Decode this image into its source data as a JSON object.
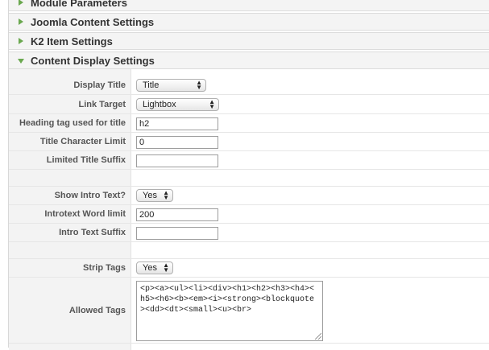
{
  "panels": [
    {
      "title": "Module Parameters",
      "expanded": false
    },
    {
      "title": "Joomla Content Settings",
      "expanded": false
    },
    {
      "title": "K2 Item Settings",
      "expanded": false
    },
    {
      "title": "Content Display Settings",
      "expanded": true
    }
  ],
  "fields": {
    "display_title": {
      "label": "Display Title",
      "value": "Title"
    },
    "link_target": {
      "label": "Link Target",
      "value": "Lightbox"
    },
    "heading_tag": {
      "label": "Heading tag used for title",
      "value": "h2"
    },
    "title_char_limit": {
      "label": "Title Character Limit",
      "value": "0"
    },
    "limited_title_suffix": {
      "label": "Limited Title Suffix",
      "value": ""
    },
    "show_intro_text": {
      "label": "Show Intro Text?",
      "value": "Yes"
    },
    "introtext_word_limit": {
      "label": "Introtext Word limit",
      "value": "200"
    },
    "intro_text_suffix": {
      "label": "Intro Text Suffix",
      "value": ""
    },
    "strip_tags": {
      "label": "Strip Tags",
      "value": "Yes"
    },
    "allowed_tags": {
      "label": "Allowed Tags",
      "value": "<p><a><ul><li><div><h1><h2><h3><h4><h5><h6><b><em><i><strong><blockquote><dd><dt><small><u><br>"
    }
  },
  "colors": {
    "accent_arrow": "#6aa84f"
  }
}
